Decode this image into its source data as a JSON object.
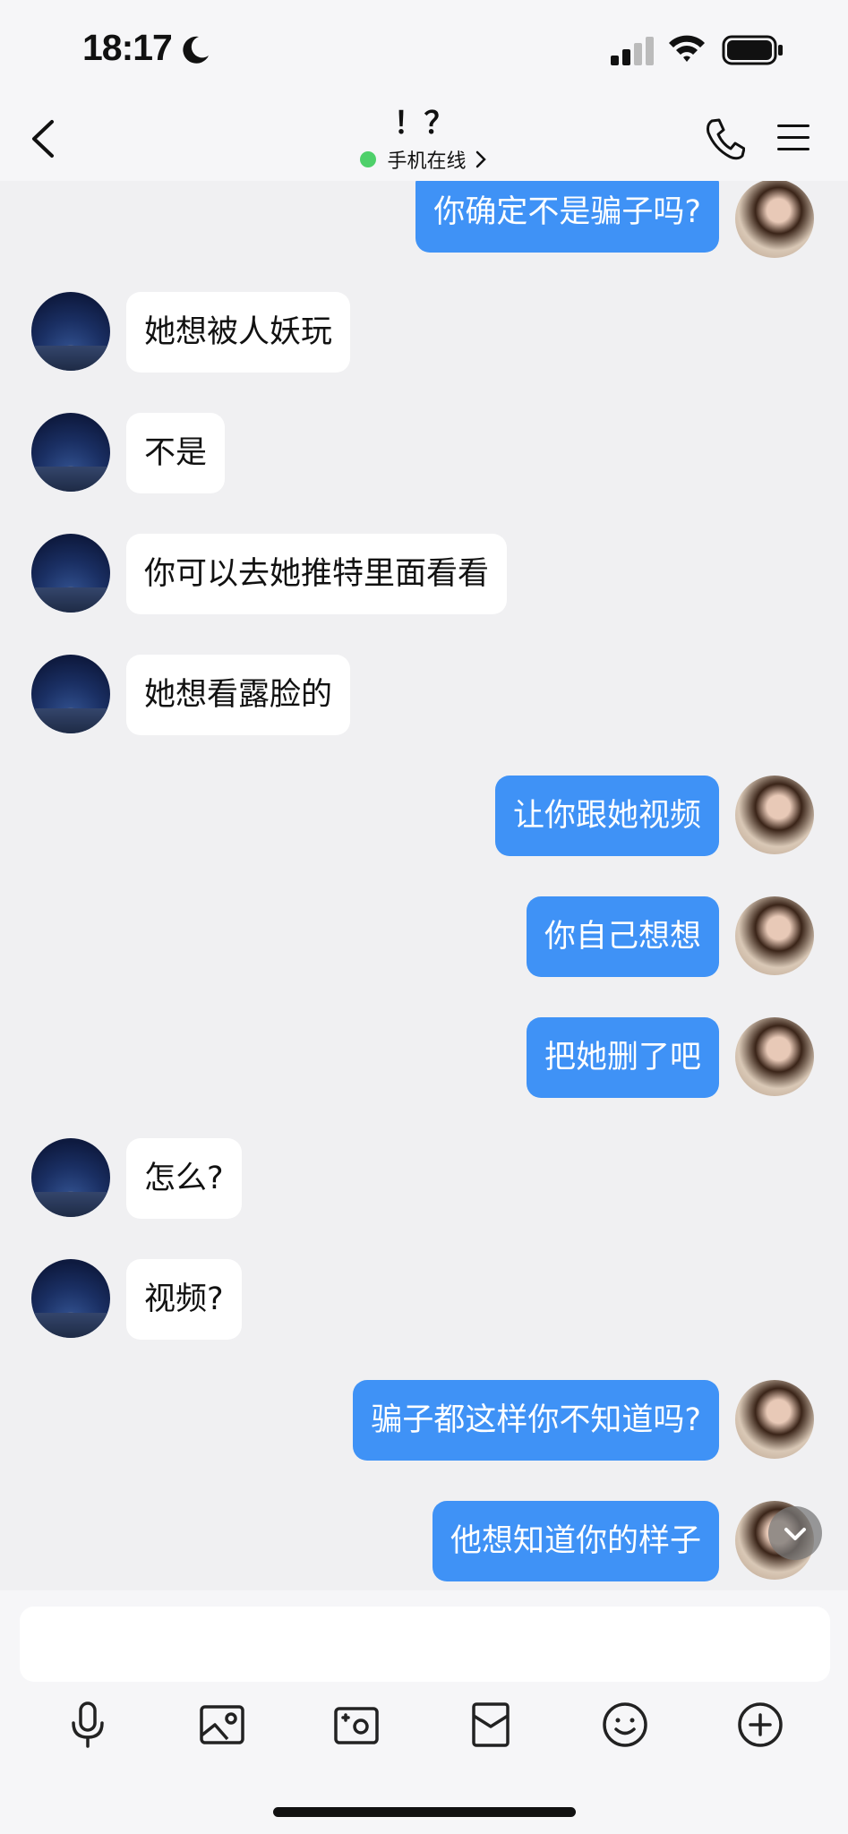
{
  "status": {
    "time": "18:17"
  },
  "header": {
    "title": "！？",
    "online_status": "手机在线"
  },
  "messages": [
    {
      "side": "right",
      "text": "你确定不是骗子吗?"
    },
    {
      "side": "left",
      "text": "她想被人妖玩"
    },
    {
      "side": "left",
      "text": "不是"
    },
    {
      "side": "left",
      "text": "你可以去她推特里面看看"
    },
    {
      "side": "left",
      "text": "她想看露脸的"
    },
    {
      "side": "right",
      "text": "让你跟她视频"
    },
    {
      "side": "right",
      "text": "你自己想想"
    },
    {
      "side": "right",
      "text": "把她删了吧"
    },
    {
      "side": "left",
      "text": "怎么?"
    },
    {
      "side": "left",
      "text": "视频?"
    },
    {
      "side": "right",
      "text": "骗子都这样你不知道吗?"
    },
    {
      "side": "right",
      "text": "他想知道你的样子"
    }
  ],
  "input": {
    "value": "",
    "placeholder": ""
  },
  "toolbar": [
    "microphone-icon",
    "image-icon",
    "camera-icon",
    "red-envelope-icon",
    "emoji-icon",
    "plus-icon"
  ]
}
